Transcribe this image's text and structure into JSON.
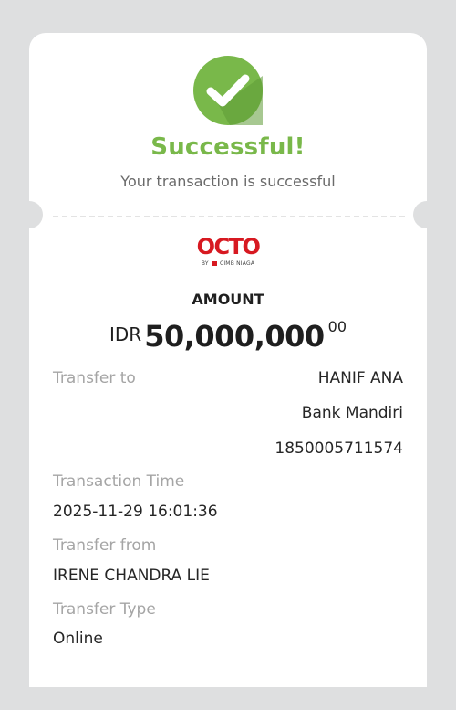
{
  "status": {
    "title": "Successful!",
    "subtitle": "Your transaction is successful",
    "accent_color": "#79b84a",
    "icon": "check-circle-icon"
  },
  "brand": {
    "logo_text": "OCTO",
    "logo_sub_by": "BY",
    "logo_sub_bank": "CIMB NIAGA",
    "brand_color": "#d71921"
  },
  "amount": {
    "label": "AMOUNT",
    "currency": "IDR",
    "value": "50,000,000",
    "decimals": "00"
  },
  "details": {
    "transfer_to": {
      "label": "Transfer to",
      "name": "HANIF ANA",
      "bank": "Bank Mandiri",
      "account": "1850005711574"
    },
    "transaction_time": {
      "label": "Transaction Time",
      "value": "2025-11-29 16:01:36"
    },
    "transfer_from": {
      "label": "Transfer from",
      "value": "IRENE CHANDRA LIE"
    },
    "transfer_type": {
      "label": "Transfer Type",
      "value": "Online"
    }
  }
}
